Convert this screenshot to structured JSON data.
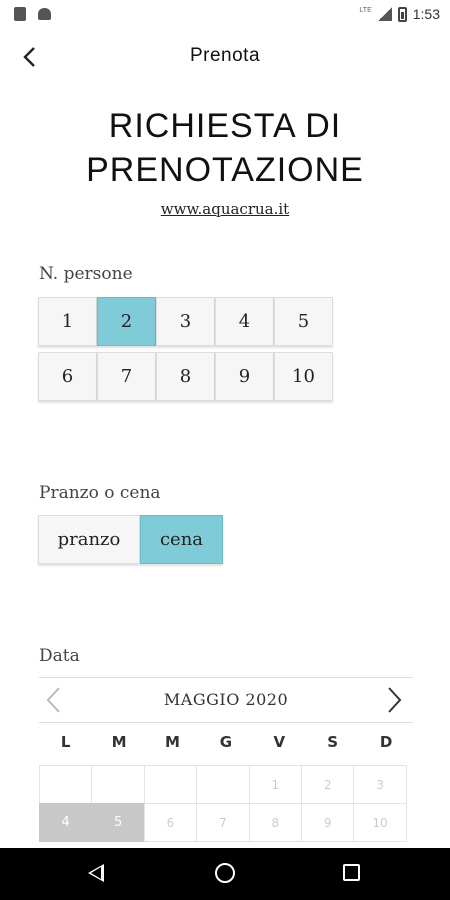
{
  "status_bar": {
    "network": "LTE",
    "time": "1:53"
  },
  "app_bar": {
    "title": "Prenota",
    "back_icon": "back-arrow-icon"
  },
  "headline": {
    "line1": "RICHIESTA DI",
    "line2": "PRENOTAZIONE"
  },
  "site_link": "www.aquacrua.it",
  "persons": {
    "label": "N. persone",
    "row1": [
      "1",
      "2",
      "3",
      "4",
      "5"
    ],
    "row2": [
      "6",
      "7",
      "8",
      "9",
      "10"
    ],
    "selected": "2"
  },
  "meal": {
    "label": "Pranzo o cena",
    "lunch": "pranzo",
    "dinner": "cena",
    "selected": "cena"
  },
  "calendar": {
    "label": "Data",
    "month": "MAGGIO 2020",
    "weekdays": [
      "L",
      "M",
      "M",
      "G",
      "V",
      "S",
      "D"
    ],
    "row1": [
      "",
      "",
      "",
      "",
      "1",
      "2",
      "3"
    ],
    "row2": [
      "4",
      "5",
      "6",
      "7",
      "8",
      "9",
      "10"
    ]
  },
  "colors": {
    "selected": "#7fcbd7",
    "past_day": "#c8c8c8"
  }
}
